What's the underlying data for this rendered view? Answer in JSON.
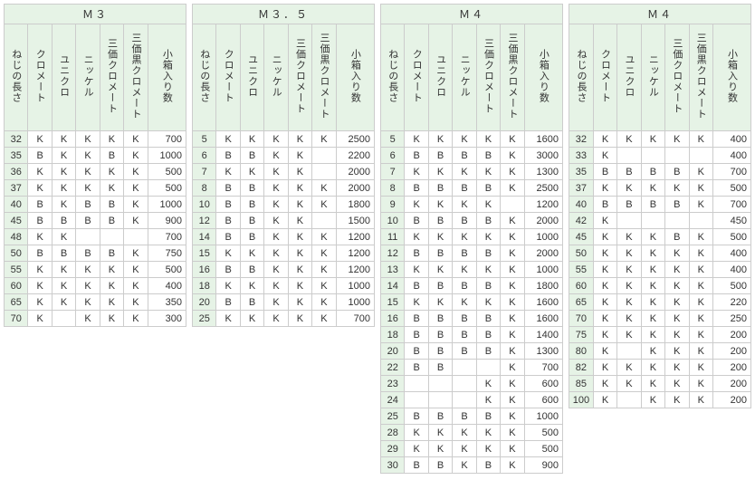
{
  "columns": [
    "ねじの長さ",
    "クロメート",
    "ユニクロ",
    "ニッケル",
    "三価クロメート",
    "三価黒クロメート",
    "小箱入り数"
  ],
  "tables": [
    {
      "title": "Ｍ３",
      "rows": [
        [
          "32",
          "K",
          "K",
          "K",
          "K",
          "K",
          "700"
        ],
        [
          "35",
          "B",
          "K",
          "K",
          "B",
          "K",
          "1000"
        ],
        [
          "36",
          "K",
          "K",
          "K",
          "K",
          "K",
          "500"
        ],
        [
          "37",
          "K",
          "K",
          "K",
          "K",
          "K",
          "500"
        ],
        [
          "40",
          "B",
          "K",
          "B",
          "B",
          "K",
          "1000"
        ],
        [
          "45",
          "B",
          "B",
          "B",
          "B",
          "K",
          "900"
        ],
        [
          "48",
          "K",
          "K",
          "",
          "",
          "",
          "700"
        ],
        [
          "50",
          "B",
          "B",
          "B",
          "B",
          "K",
          "750"
        ],
        [
          "55",
          "K",
          "K",
          "K",
          "K",
          "K",
          "500"
        ],
        [
          "60",
          "K",
          "K",
          "K",
          "K",
          "K",
          "400"
        ],
        [
          "65",
          "K",
          "K",
          "K",
          "K",
          "K",
          "350"
        ],
        [
          "70",
          "K",
          "",
          "K",
          "K",
          "K",
          "300"
        ]
      ]
    },
    {
      "title": "Ｍ３．５",
      "rows": [
        [
          "5",
          "K",
          "K",
          "K",
          "K",
          "K",
          "2500"
        ],
        [
          "6",
          "B",
          "B",
          "K",
          "K",
          "",
          "2200"
        ],
        [
          "7",
          "K",
          "K",
          "K",
          "K",
          "",
          "2000"
        ],
        [
          "8",
          "B",
          "B",
          "K",
          "K",
          "K",
          "2000"
        ],
        [
          "10",
          "B",
          "B",
          "K",
          "K",
          "K",
          "1800"
        ],
        [
          "12",
          "B",
          "B",
          "K",
          "K",
          "",
          "1500"
        ],
        [
          "14",
          "B",
          "B",
          "K",
          "K",
          "K",
          "1200"
        ],
        [
          "15",
          "K",
          "K",
          "K",
          "K",
          "K",
          "1200"
        ],
        [
          "16",
          "B",
          "B",
          "K",
          "K",
          "K",
          "1200"
        ],
        [
          "18",
          "K",
          "K",
          "K",
          "K",
          "K",
          "1000"
        ],
        [
          "20",
          "B",
          "B",
          "K",
          "K",
          "K",
          "1000"
        ],
        [
          "25",
          "K",
          "K",
          "K",
          "K",
          "K",
          "700"
        ]
      ]
    },
    {
      "title": "Ｍ４",
      "rows": [
        [
          "5",
          "K",
          "K",
          "K",
          "K",
          "K",
          "1600"
        ],
        [
          "6",
          "B",
          "B",
          "B",
          "B",
          "K",
          "3000"
        ],
        [
          "7",
          "K",
          "K",
          "K",
          "K",
          "K",
          "1300"
        ],
        [
          "8",
          "B",
          "B",
          "B",
          "B",
          "K",
          "2500"
        ],
        [
          "9",
          "K",
          "K",
          "K",
          "K",
          "",
          "1200"
        ],
        [
          "10",
          "B",
          "B",
          "B",
          "B",
          "K",
          "2000"
        ],
        [
          "11",
          "K",
          "K",
          "K",
          "K",
          "K",
          "1000"
        ],
        [
          "12",
          "B",
          "B",
          "B",
          "B",
          "K",
          "2000"
        ],
        [
          "13",
          "K",
          "K",
          "K",
          "K",
          "K",
          "1000"
        ],
        [
          "14",
          "B",
          "B",
          "B",
          "B",
          "K",
          "1800"
        ],
        [
          "15",
          "K",
          "K",
          "K",
          "K",
          "K",
          "1600"
        ],
        [
          "16",
          "B",
          "B",
          "B",
          "B",
          "K",
          "1600"
        ],
        [
          "18",
          "B",
          "B",
          "B",
          "B",
          "K",
          "1400"
        ],
        [
          "20",
          "B",
          "B",
          "B",
          "B",
          "K",
          "1300"
        ],
        [
          "22",
          "B",
          "B",
          "",
          "",
          "K",
          "700"
        ],
        [
          "23",
          "",
          "",
          "",
          "K",
          "K",
          "600"
        ],
        [
          "24",
          "",
          "",
          "",
          "K",
          "K",
          "600"
        ],
        [
          "25",
          "B",
          "B",
          "B",
          "B",
          "K",
          "1000"
        ],
        [
          "28",
          "K",
          "K",
          "K",
          "K",
          "K",
          "500"
        ],
        [
          "29",
          "K",
          "K",
          "K",
          "K",
          "K",
          "500"
        ],
        [
          "30",
          "B",
          "B",
          "K",
          "B",
          "K",
          "900"
        ]
      ]
    },
    {
      "title": "Ｍ４",
      "rows": [
        [
          "32",
          "K",
          "K",
          "K",
          "K",
          "K",
          "400"
        ],
        [
          "33",
          "K",
          "",
          "",
          "",
          "",
          "400"
        ],
        [
          "35",
          "B",
          "B",
          "B",
          "B",
          "K",
          "700"
        ],
        [
          "37",
          "K",
          "K",
          "K",
          "K",
          "K",
          "500"
        ],
        [
          "40",
          "B",
          "B",
          "B",
          "B",
          "K",
          "700"
        ],
        [
          "42",
          "K",
          "",
          "",
          "",
          "",
          "450"
        ],
        [
          "45",
          "K",
          "K",
          "K",
          "B",
          "K",
          "500"
        ],
        [
          "50",
          "K",
          "K",
          "K",
          "K",
          "K",
          "400"
        ],
        [
          "55",
          "K",
          "K",
          "K",
          "K",
          "K",
          "400"
        ],
        [
          "60",
          "K",
          "K",
          "K",
          "K",
          "K",
          "500"
        ],
        [
          "65",
          "K",
          "K",
          "K",
          "K",
          "K",
          "220"
        ],
        [
          "70",
          "K",
          "K",
          "K",
          "K",
          "K",
          "250"
        ],
        [
          "75",
          "K",
          "K",
          "K",
          "K",
          "K",
          "200"
        ],
        [
          "80",
          "K",
          "",
          "K",
          "K",
          "K",
          "200"
        ],
        [
          "82",
          "K",
          "K",
          "K",
          "K",
          "K",
          "200"
        ],
        [
          "85",
          "K",
          "K",
          "K",
          "K",
          "K",
          "200"
        ],
        [
          "100",
          "K",
          "",
          "K",
          "K",
          "K",
          "200"
        ]
      ]
    }
  ]
}
